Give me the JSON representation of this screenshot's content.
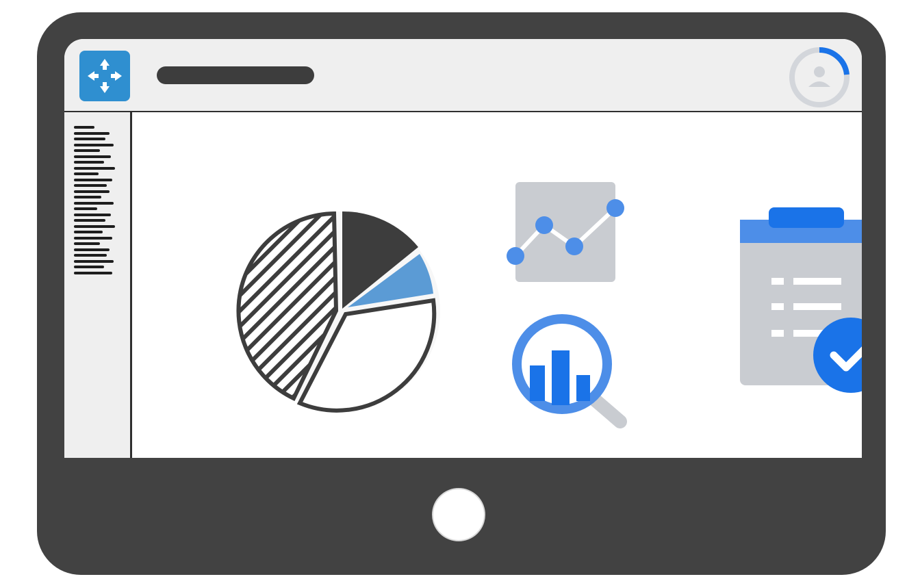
{
  "device": {
    "type": "tablet",
    "frame_color": "#424242"
  },
  "header": {
    "app_logo_icon": "expand-arrows-icon",
    "title_placeholder": "",
    "avatar_icon": "user-avatar-icon"
  },
  "sidebar": {
    "items_icon": "text-lines-placeholder"
  },
  "widgets": [
    {
      "name": "pie-chart",
      "icon": "pie-chart-icon"
    },
    {
      "name": "line-chart",
      "icon": "line-chart-icon"
    },
    {
      "name": "analytics",
      "icon": "magnifier-bar-chart-icon"
    },
    {
      "name": "checklist",
      "icon": "clipboard-check-icon"
    }
  ],
  "colors": {
    "accent_blue": "#1a73e8",
    "light_blue": "#5b9bd5",
    "dark": "#3d3d3d",
    "panel_gray": "#efefef",
    "card_gray": "#c9ccd1"
  }
}
